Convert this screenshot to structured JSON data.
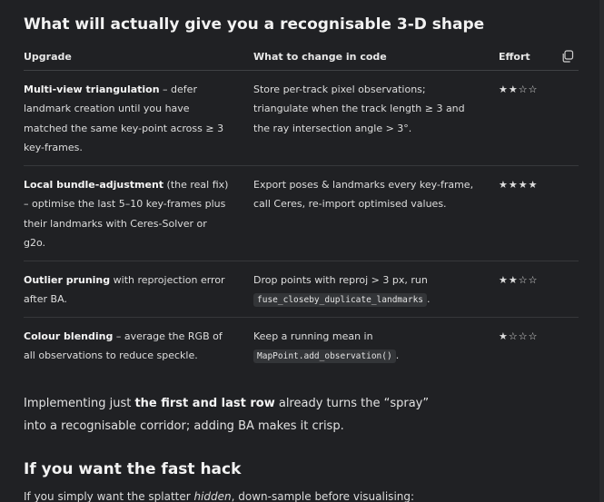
{
  "headings": {
    "top": "What will actually give you a recognisable 3-D shape",
    "fast": "If you want the fast hack"
  },
  "table": {
    "columns": [
      "Upgrade",
      "What to change in code",
      "Effort"
    ],
    "rows": [
      {
        "upgrade_bold": "Multi-view triangulation",
        "upgrade_rest": " – defer landmark creation until you have matched the same key-point across ≥ 3 key-frames.",
        "change_pre": "Store per-track pixel observations; triangulate when the track length ≥ 3 and the ray intersection angle > 3°.",
        "change_code": "",
        "change_post": "",
        "effort": "★★☆☆"
      },
      {
        "upgrade_bold": "Local bundle-adjustment",
        "upgrade_rest": " (the real fix) – optimise the last 5–10 key-frames plus their landmarks with Ceres-Solver or g2o.",
        "change_pre": "Export poses & landmarks every key-frame, call Ceres, re-import optimised values.",
        "change_code": "",
        "change_post": "",
        "effort": "★★★★"
      },
      {
        "upgrade_bold": "Outlier pruning",
        "upgrade_rest": " with reprojection error after BA.",
        "change_pre": "Drop points with reproj > 3 px, run ",
        "change_code": "fuse_closeby_duplicate_landmarks",
        "change_post": ".",
        "effort": "★★☆☆"
      },
      {
        "upgrade_bold": "Colour blending",
        "upgrade_rest": " – average the RGB of all observations to reduce speckle.",
        "change_pre": "Keep a running mean in ",
        "change_code": "MapPoint.add_observation()",
        "change_post": ".",
        "effort": "★☆☆☆"
      }
    ]
  },
  "paragraph": {
    "pre": "Implementing just ",
    "bold": "the first and last row",
    "post": " already turns the “spray” into a recognisable corridor; adding BA makes it crisp."
  },
  "tail": {
    "pre": "If you simply want the splatter ",
    "em": "hidden",
    "post": ", down-sample before visualising:"
  },
  "icons": {
    "copy": "copy-icon"
  }
}
